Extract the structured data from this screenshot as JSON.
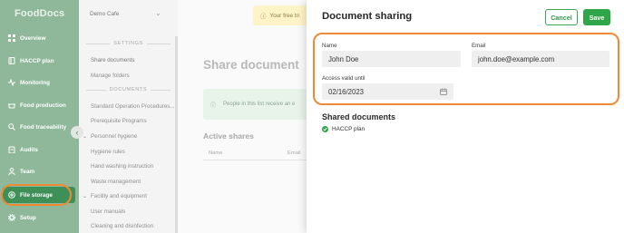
{
  "nav": {
    "logo": "FoodDocs",
    "items": [
      {
        "label": "Overview",
        "icon": "grid-icon"
      },
      {
        "label": "HACCP plan",
        "icon": "book-icon"
      },
      {
        "label": "Monitoring",
        "icon": "pulse-icon"
      },
      {
        "label": "Food production",
        "icon": "pot-icon"
      },
      {
        "label": "Food traceability",
        "icon": "magnifier-icon"
      },
      {
        "label": "Audits",
        "icon": "clipboard-icon"
      },
      {
        "label": "Team",
        "icon": "person-icon"
      },
      {
        "label": "File storage",
        "icon": "folder-icon",
        "active": true
      },
      {
        "label": "Setup",
        "icon": "gear-icon"
      }
    ]
  },
  "subnav": {
    "org": "Demo Cafe",
    "settings_heading": "SETTINGS",
    "settings_links": [
      "Share documents",
      "Manage folders"
    ],
    "documents_heading": "DOCUMENTS",
    "links": [
      "Standard Operation Procedures...",
      "Prerequisite Programs",
      "Personnel hygiene",
      "Hygiene rules",
      "Hand washing instruction",
      "Waste management",
      "Facility and equipment",
      "User manuals",
      "Cleaning and disinfection"
    ]
  },
  "main": {
    "trial_text": "Your free tri",
    "title": "Share document",
    "info_text": "People in this list receive an e",
    "active_title": "Active shares",
    "col_name": "Name",
    "col_email": "Email"
  },
  "drawer": {
    "title": "Document sharing",
    "cancel_label": "Cancel",
    "save_label": "Save",
    "name_label": "Name",
    "name_value": "John Doe",
    "email_label": "Email",
    "email_value": "john.doe@example.com",
    "valid_label": "Access valid until",
    "valid_value": "02/16/2023",
    "shared_title": "Shared documents",
    "docs": [
      "HACCP plan"
    ]
  },
  "colors": {
    "accent": "#2fa648",
    "highlight": "#f08a34",
    "nav_bg": "#8fb89a"
  }
}
